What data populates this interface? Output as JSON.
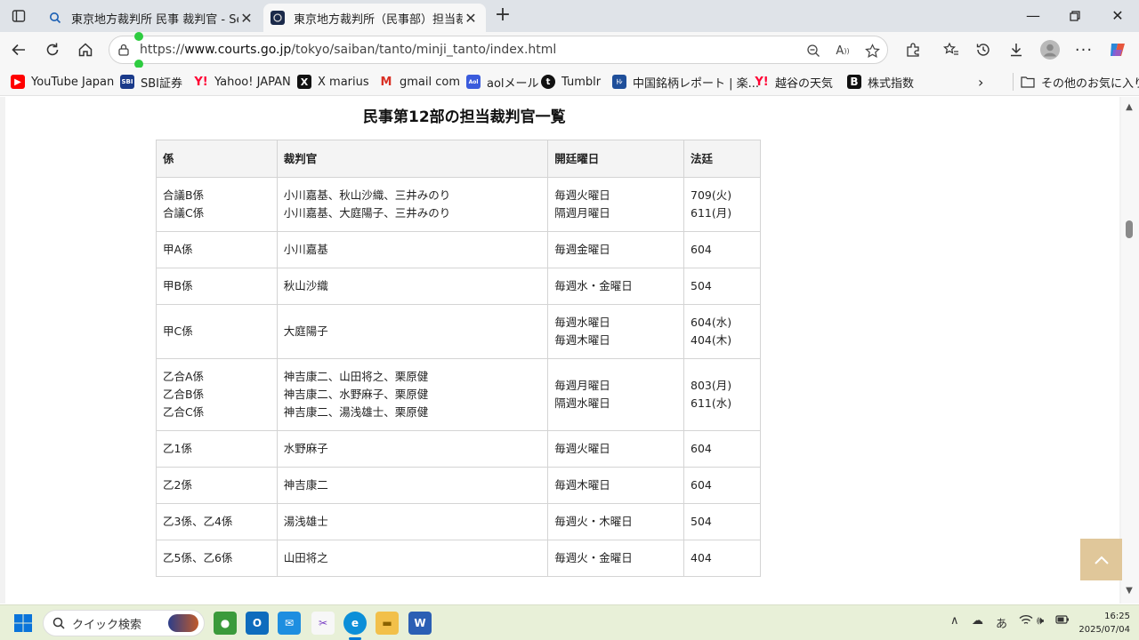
{
  "tabs": [
    {
      "label": "東京地方裁判所 民事 裁判官 - Sea",
      "active": false
    },
    {
      "label": "東京地方裁判所（民事部）担当裁",
      "active": true
    }
  ],
  "address_bar": {
    "url_prefix": "https://",
    "url_host": "www.courts.go.jp",
    "url_path": "/tokyo/saiban/tanto/minji_tanto/index.html"
  },
  "bookmarks": [
    {
      "label": "YouTube Japan",
      "icon": "youtube-icon"
    },
    {
      "label": "SBI証券",
      "icon": "sbi-icon"
    },
    {
      "label": "Yahoo! JAPAN",
      "icon": "yahoo-icon"
    },
    {
      "label": "X marius",
      "icon": "x-icon"
    },
    {
      "label": "gmail com",
      "icon": "gmail-icon"
    },
    {
      "label": "aolメール",
      "icon": "aol-icon"
    },
    {
      "label": "Tumblr",
      "icon": "tumblr-icon"
    },
    {
      "label": "中国銘柄レポート | 楽...",
      "icon": "rakuten-icon"
    },
    {
      "label": "越谷の天気",
      "icon": "yahoo-icon"
    },
    {
      "label": "株式指数",
      "icon": "b-icon"
    }
  ],
  "other_favorites": "その他のお気に入り",
  "page": {
    "heading": "民事第12部の担当裁判官一覧",
    "headers": [
      "係",
      "裁判官",
      "開廷曜日",
      "法廷"
    ],
    "rows": [
      {
        "kakari": [
          "合議B係",
          "合議C係"
        ],
        "judges": [
          "小川嘉基、秋山沙織、三井みのり",
          "小川嘉基、大庭陽子、三井みのり"
        ],
        "days": [
          "毎週火曜日",
          "隔週月曜日"
        ],
        "court": [
          "709(火)",
          "611(月)"
        ]
      },
      {
        "kakari": [
          "甲A係"
        ],
        "judges": [
          "小川嘉基"
        ],
        "days": [
          "毎週金曜日"
        ],
        "court": [
          "604"
        ]
      },
      {
        "kakari": [
          "甲B係"
        ],
        "judges": [
          "秋山沙織"
        ],
        "days": [
          "毎週水・金曜日"
        ],
        "court": [
          "504"
        ]
      },
      {
        "kakari": [
          "甲C係"
        ],
        "judges": [
          "大庭陽子"
        ],
        "days": [
          "毎週水曜日",
          "毎週木曜日"
        ],
        "court": [
          "604(水)",
          "404(木)"
        ]
      },
      {
        "kakari": [
          "乙合A係",
          "乙合B係",
          "乙合C係"
        ],
        "judges": [
          "神吉康二、山田将之、栗原健",
          "神吉康二、水野麻子、栗原健",
          "神吉康二、湯浅雄士、栗原健"
        ],
        "days": [
          "毎週月曜日",
          "隔週水曜日"
        ],
        "court": [
          "803(月)",
          "611(水)"
        ]
      },
      {
        "kakari": [
          "乙1係"
        ],
        "judges": [
          "水野麻子"
        ],
        "days": [
          "毎週火曜日"
        ],
        "court": [
          "604"
        ]
      },
      {
        "kakari": [
          "乙2係"
        ],
        "judges": [
          "神吉康二"
        ],
        "days": [
          "毎週木曜日"
        ],
        "court": [
          "604"
        ]
      },
      {
        "kakari": [
          "乙3係、乙4係"
        ],
        "judges": [
          "湯浅雄士"
        ],
        "days": [
          "毎週火・木曜日"
        ],
        "court": [
          "504"
        ]
      },
      {
        "kakari": [
          "乙5係、乙6係"
        ],
        "judges": [
          "山田将之"
        ],
        "days": [
          "毎週火・金曜日"
        ],
        "court": [
          "404"
        ]
      }
    ]
  },
  "taskbar": {
    "search_placeholder": "クイック検索",
    "ime": "あ",
    "time": "16:25",
    "date": "2025/07/04"
  },
  "colors": {
    "back_to_top": "#e0c79a",
    "taskbar": "#e8f0d8",
    "tab_strip": "#dfe3e8"
  }
}
